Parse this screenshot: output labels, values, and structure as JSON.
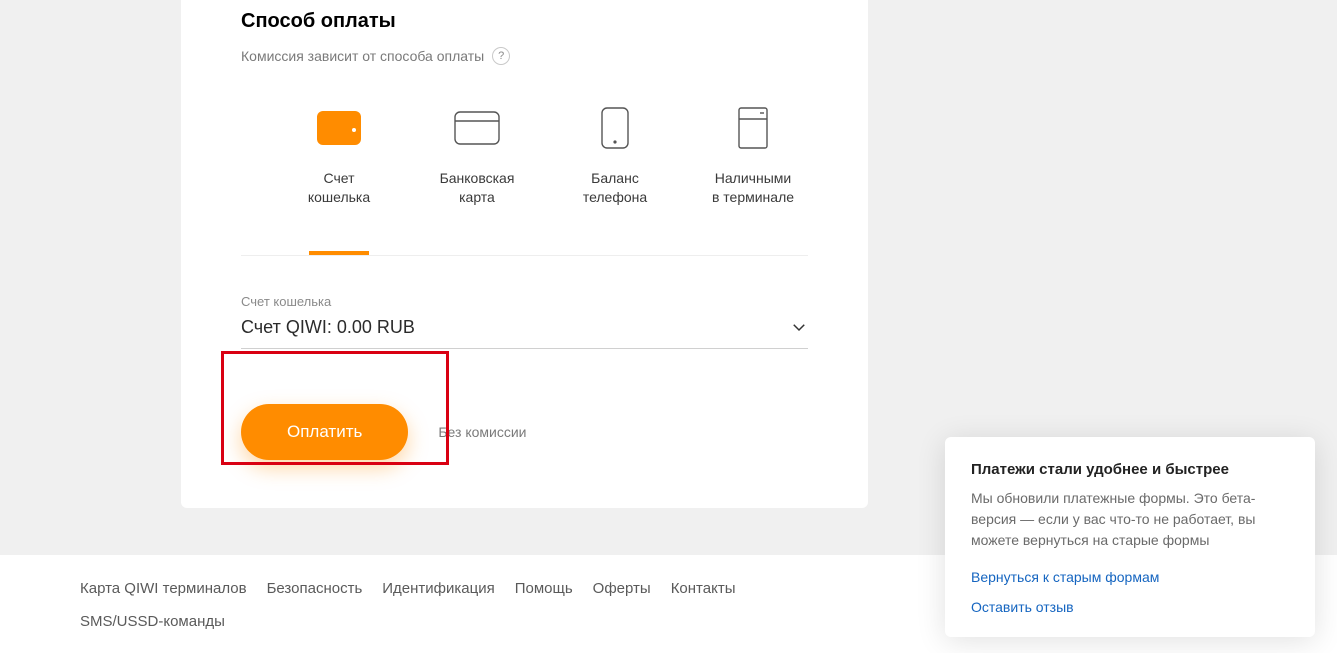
{
  "payment": {
    "title": "Способ оплаты",
    "fee_hint": "Комиссия зависит от способа оплаты",
    "help_symbol": "?",
    "methods": [
      {
        "id": "wallet",
        "label": "Счет\nкошелька",
        "active": true
      },
      {
        "id": "card",
        "label": "Банковская\nкарта",
        "active": false
      },
      {
        "id": "phone",
        "label": "Баланс\nтелефона",
        "active": false
      },
      {
        "id": "terminal",
        "label": "Наличными\nв терминале",
        "active": false
      }
    ],
    "account_field": {
      "label": "Счет кошелька",
      "value": "Счет QIWI: 0.00 RUB"
    },
    "pay_button": "Оплатить",
    "fee_note": "Без комиссии"
  },
  "footer_links": [
    "Карта QIWI терминалов",
    "Безопасность",
    "Идентификация",
    "Помощь",
    "Оферты",
    "Контакты",
    "SMS/USSD-команды"
  ],
  "popup": {
    "title": "Платежи стали удобнее и быстрее",
    "text": "Мы обновили платежные формы.\nЭто бета-версия — если у вас что-то не работает, вы можете вернуться на старые формы",
    "link_back": "Вернуться к старым формам",
    "link_feedback": "Оставить отзыв"
  }
}
